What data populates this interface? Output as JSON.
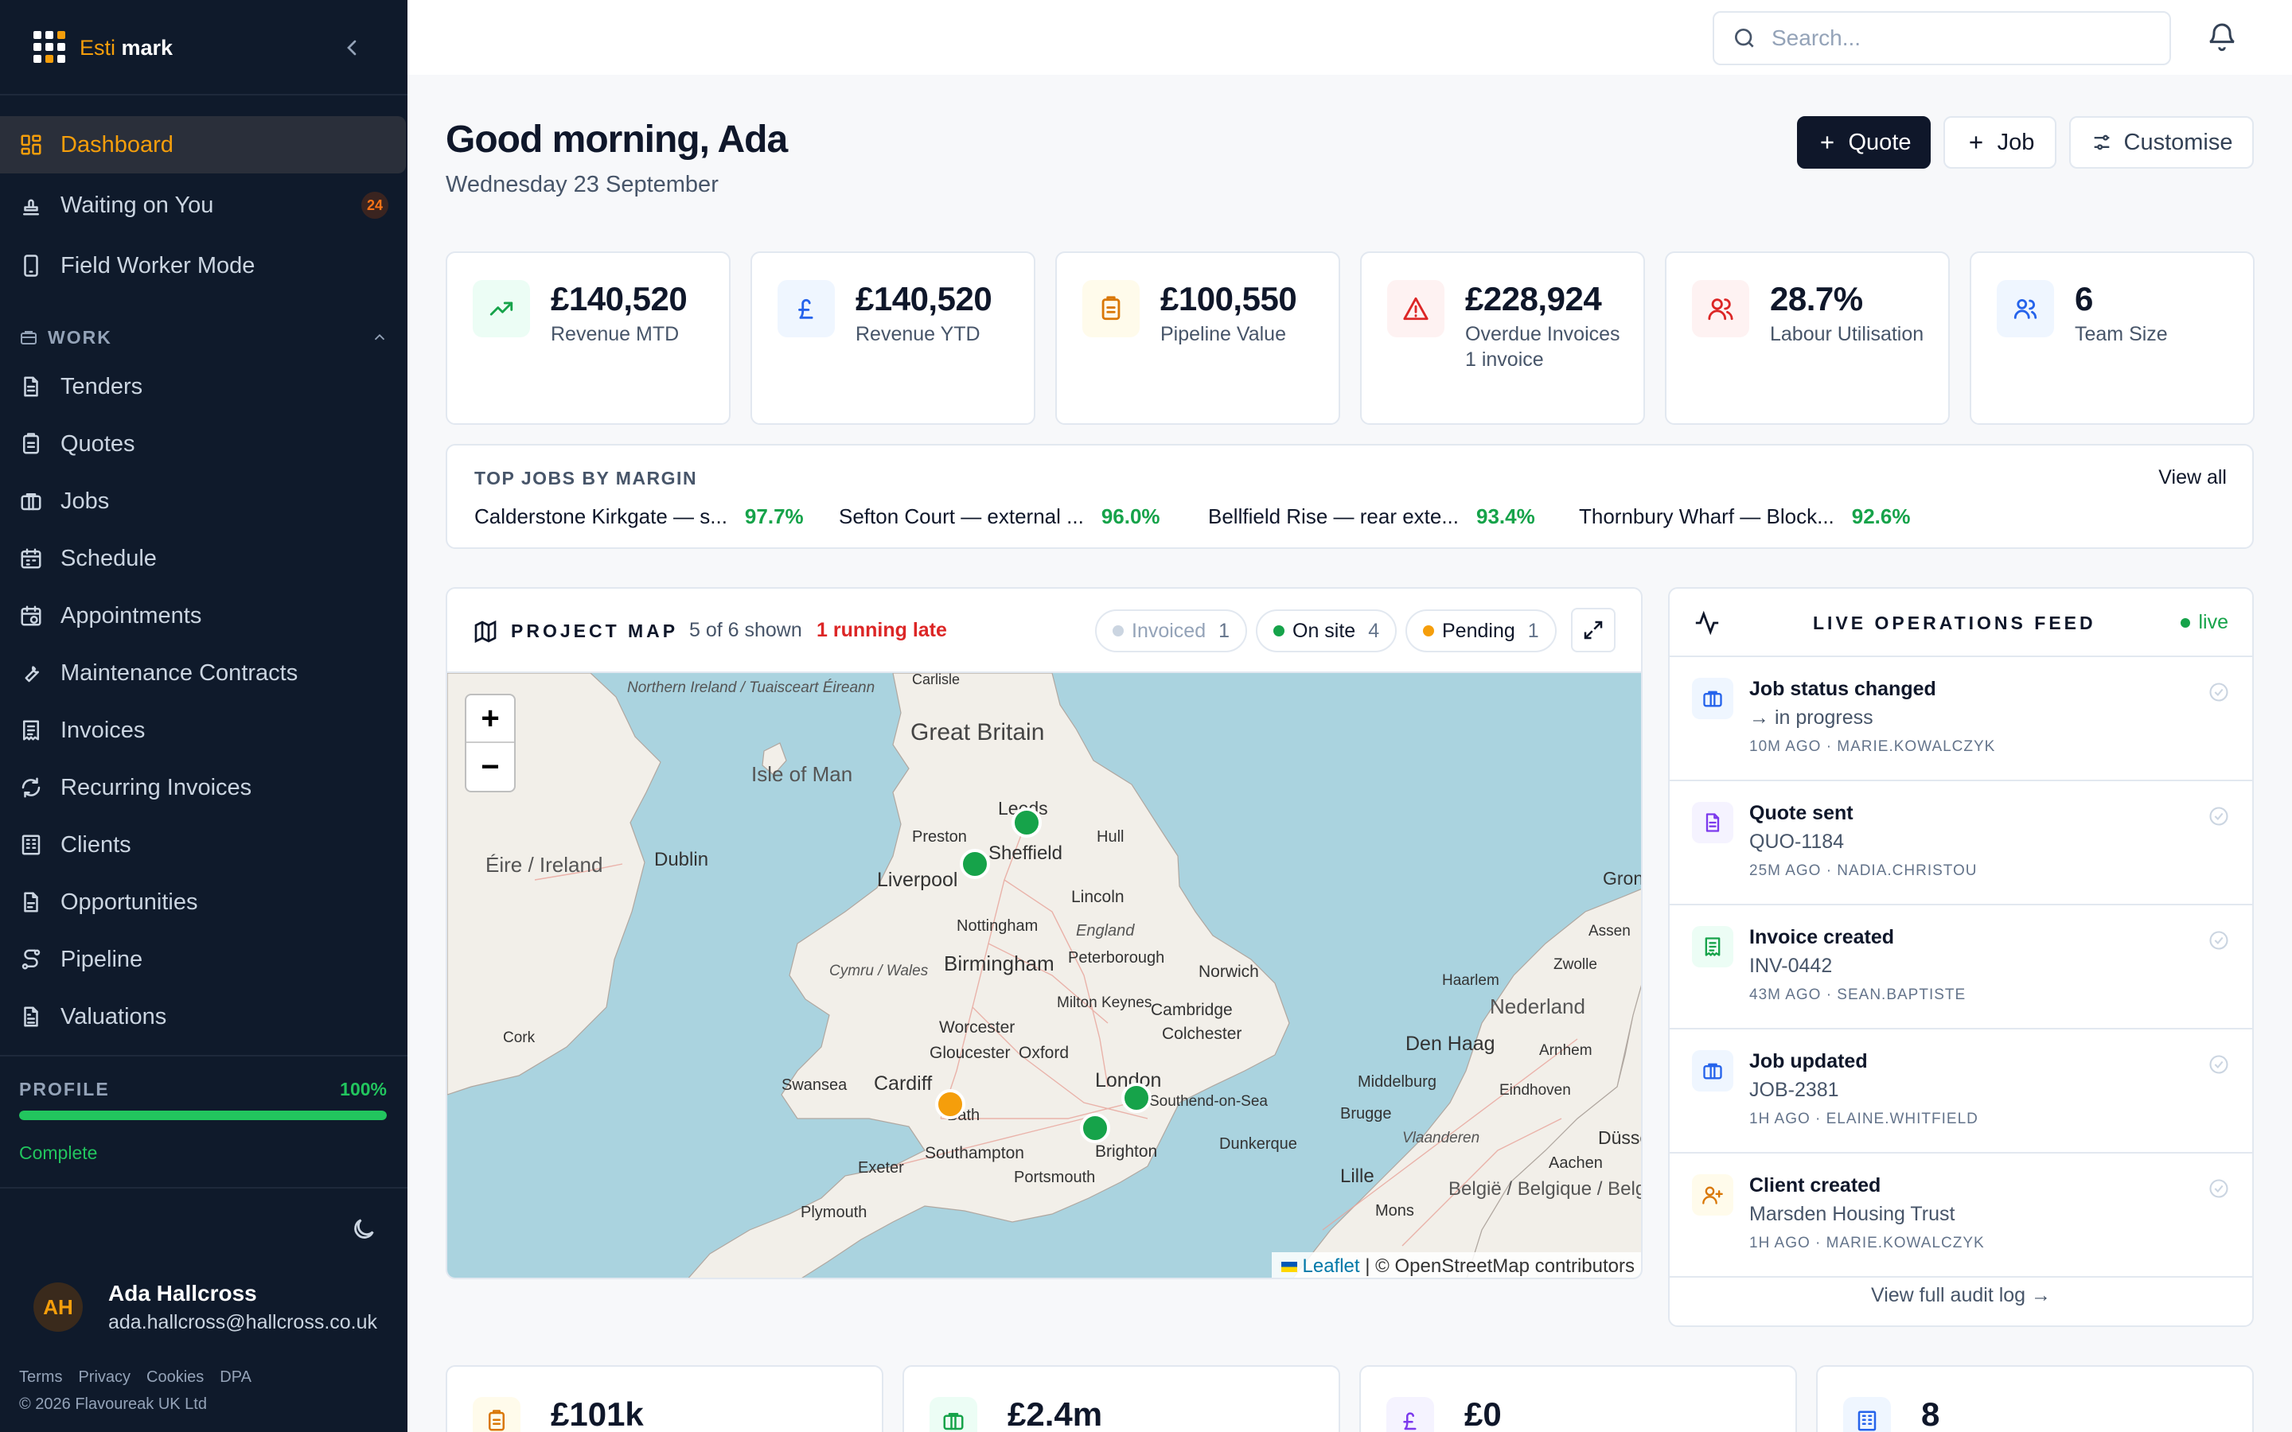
{
  "app": {
    "brand_a": "Esti",
    "brand_b": "mark"
  },
  "sidebar": {
    "top_items": [
      {
        "label": "Dashboard",
        "icon": "dashboard-icon",
        "active": true
      },
      {
        "label": "Waiting on You",
        "icon": "stamp-icon",
        "badge": "24"
      },
      {
        "label": "Field Worker Mode",
        "icon": "phone-icon"
      }
    ],
    "work_section": "WORK",
    "work_items": [
      {
        "label": "Tenders",
        "icon": "document-icon"
      },
      {
        "label": "Quotes",
        "icon": "clipboard-icon"
      },
      {
        "label": "Jobs",
        "icon": "briefcase-icon"
      },
      {
        "label": "Schedule",
        "icon": "calendar-icon"
      },
      {
        "label": "Appointments",
        "icon": "calendar-clock-icon"
      },
      {
        "label": "Maintenance Contracts",
        "icon": "wrench-icon"
      },
      {
        "label": "Invoices",
        "icon": "receipt-icon"
      },
      {
        "label": "Recurring Invoices",
        "icon": "refresh-icon"
      },
      {
        "label": "Clients",
        "icon": "building-icon"
      },
      {
        "label": "Opportunities",
        "icon": "file-icon"
      },
      {
        "label": "Pipeline",
        "icon": "route-icon"
      },
      {
        "label": "Valuations",
        "icon": "file-text-icon"
      }
    ],
    "profile": {
      "label": "PROFILE",
      "percent_text": "100%",
      "percent": 100,
      "status": "Complete"
    },
    "user": {
      "initials": "AH",
      "name": "Ada Hallcross",
      "email": "ada.hallcross@hallcross.co.uk"
    },
    "legal": [
      "Terms",
      "Privacy",
      "Cookies",
      "DPA"
    ],
    "copyright": "© 2026 Flavoureak UK Ltd"
  },
  "topbar": {
    "search_placeholder": "Search..."
  },
  "header": {
    "greeting": "Good morning, Ada",
    "date": "Wednesday 23 September",
    "quote_btn": "Quote",
    "job_btn": "Job",
    "customise_btn": "Customise"
  },
  "kpis": [
    {
      "value": "£140,520",
      "label": "Revenue MTD",
      "icon": "trending-up-icon",
      "color": "#16a34a",
      "bg": "#ecfdf5"
    },
    {
      "value": "£140,520",
      "label": "Revenue YTD",
      "icon": "pound-icon",
      "color": "#2563eb",
      "bg": "#eff6ff"
    },
    {
      "value": "£100,550",
      "label": "Pipeline Value",
      "icon": "clipboard-icon",
      "color": "#d97706",
      "bg": "#fffbeb"
    },
    {
      "value": "£228,924",
      "label": "Overdue Invoices",
      "sub": "1 invoice",
      "icon": "alert-icon",
      "color": "#dc2626",
      "bg": "#fef2f2"
    },
    {
      "value": "28.7%",
      "label": "Labour Utilisation",
      "icon": "users-icon",
      "color": "#dc2626",
      "bg": "#fef2f2"
    },
    {
      "value": "6",
      "label": "Team Size",
      "icon": "team-icon",
      "color": "#2563eb",
      "bg": "#eff6ff"
    }
  ],
  "top_jobs": {
    "title": "TOP JOBS BY MARGIN",
    "view_all": "View all",
    "items": [
      {
        "name": "Calderstone Kirkgate — s...",
        "margin": "97.7%"
      },
      {
        "name": "Sefton Court — external ...",
        "margin": "96.0%"
      },
      {
        "name": "Bellfield Rise — rear exte...",
        "margin": "93.4%"
      },
      {
        "name": "Thornbury Wharf — Block...",
        "margin": "92.6%"
      }
    ]
  },
  "map": {
    "title": "PROJECT MAP",
    "shown": "5 of 6 shown",
    "late": "1 running late",
    "chips": [
      {
        "label": "Invoiced",
        "count": "1",
        "color": "#cbd5e1"
      },
      {
        "label": "On site",
        "count": "4",
        "color": "#16a34a"
      },
      {
        "label": "Pending",
        "count": "1",
        "color": "#f59e0b"
      }
    ],
    "labels": {
      "northern_ireland": "Northern Ireland / Tuaisceart Éireann",
      "gb": "Great Britain",
      "isle_of_man": "Isle of Man",
      "eire": "Éire / Ireland",
      "dublin": "Dublin",
      "cork": "Cork",
      "carlisle": "Carlisle",
      "leeds": "Leeds",
      "preston": "Preston",
      "sheffield": "Sheffield",
      "hull": "Hull",
      "liverpool": "Liverpool",
      "lincoln": "Lincoln",
      "nottingham": "Nottingham",
      "england": "England",
      "cymru": "Cymru / Wales",
      "birmingham": "Birmingham",
      "peterborough": "Peterborough",
      "norwich": "Norwich",
      "milton_keynes": "Milton Keynes",
      "cambridge": "Cambridge",
      "worcester": "Worcester",
      "colchester": "Colchester",
      "gloucester": "Gloucester",
      "oxford": "Oxford",
      "swansea": "Swansea",
      "cardiff": "Cardiff",
      "bath": "Bath",
      "london": "London",
      "southend": "Southend-on-Sea",
      "southampton": "Southampton",
      "brighton": "Brighton",
      "exeter": "Exeter",
      "portsmouth": "Portsmouth",
      "plymouth": "Plymouth",
      "dunkerque": "Dunkerque",
      "lille": "Lille",
      "mons": "Mons",
      "belgie": "België / Belgique / Belgien",
      "vlaanderen": "Vlaanderen",
      "brugge": "Brugge",
      "middelburg": "Middelburg",
      "den_haag": "Den Haag",
      "nederland": "Nederland",
      "haarlem": "Haarlem",
      "zwolle": "Zwolle",
      "assen": "Assen",
      "groningen": "Groningen",
      "arnhem": "Arnhem",
      "eindhoven": "Eindhoven",
      "aachen": "Aachen",
      "dusseldorf": "Düsseldorf"
    },
    "attribution_link": "Leaflet",
    "attribution_text": "| © OpenStreetMap contributors"
  },
  "feed": {
    "title": "LIVE OPERATIONS FEED",
    "live": "live",
    "items": [
      {
        "title": "Job status changed",
        "detail": "→ in progress",
        "meta": "10M AGO · MARIE.KOWALCZYK",
        "icon": "briefcase-icon",
        "color": "#2563eb",
        "bg": "#eff6ff"
      },
      {
        "title": "Quote sent",
        "detail": "QUO-1184",
        "meta": "25M AGO · NADIA.CHRISTOU",
        "icon": "document-icon",
        "color": "#7c3aed",
        "bg": "#f5f3ff"
      },
      {
        "title": "Invoice created",
        "detail": "INV-0442",
        "meta": "43M AGO · SEAN.BAPTISTE",
        "icon": "receipt-icon",
        "color": "#16a34a",
        "bg": "#ecfdf5"
      },
      {
        "title": "Job updated",
        "detail": "JOB-2381",
        "meta": "1H AGO · ELAINE.WHITFIELD",
        "icon": "briefcase-icon",
        "color": "#2563eb",
        "bg": "#eff6ff"
      },
      {
        "title": "Client created",
        "detail": "Marsden Housing Trust",
        "meta": "1H AGO · MARIE.KOWALCZYK",
        "icon": "user-plus-icon",
        "color": "#d97706",
        "bg": "#fffbeb"
      }
    ],
    "footer": "View full audit log →"
  },
  "kpis2": [
    {
      "value": "£101k",
      "icon": "clipboard-icon",
      "color": "#d97706",
      "bg": "#fffbeb"
    },
    {
      "value": "£2.4m",
      "icon": "briefcase-icon",
      "color": "#16a34a",
      "bg": "#ecfdf5"
    },
    {
      "value": "£0",
      "icon": "pound-icon",
      "color": "#7c3aed",
      "bg": "#f5f3ff"
    },
    {
      "value": "8",
      "icon": "building-icon",
      "color": "#2563eb",
      "bg": "#eff6ff"
    }
  ]
}
